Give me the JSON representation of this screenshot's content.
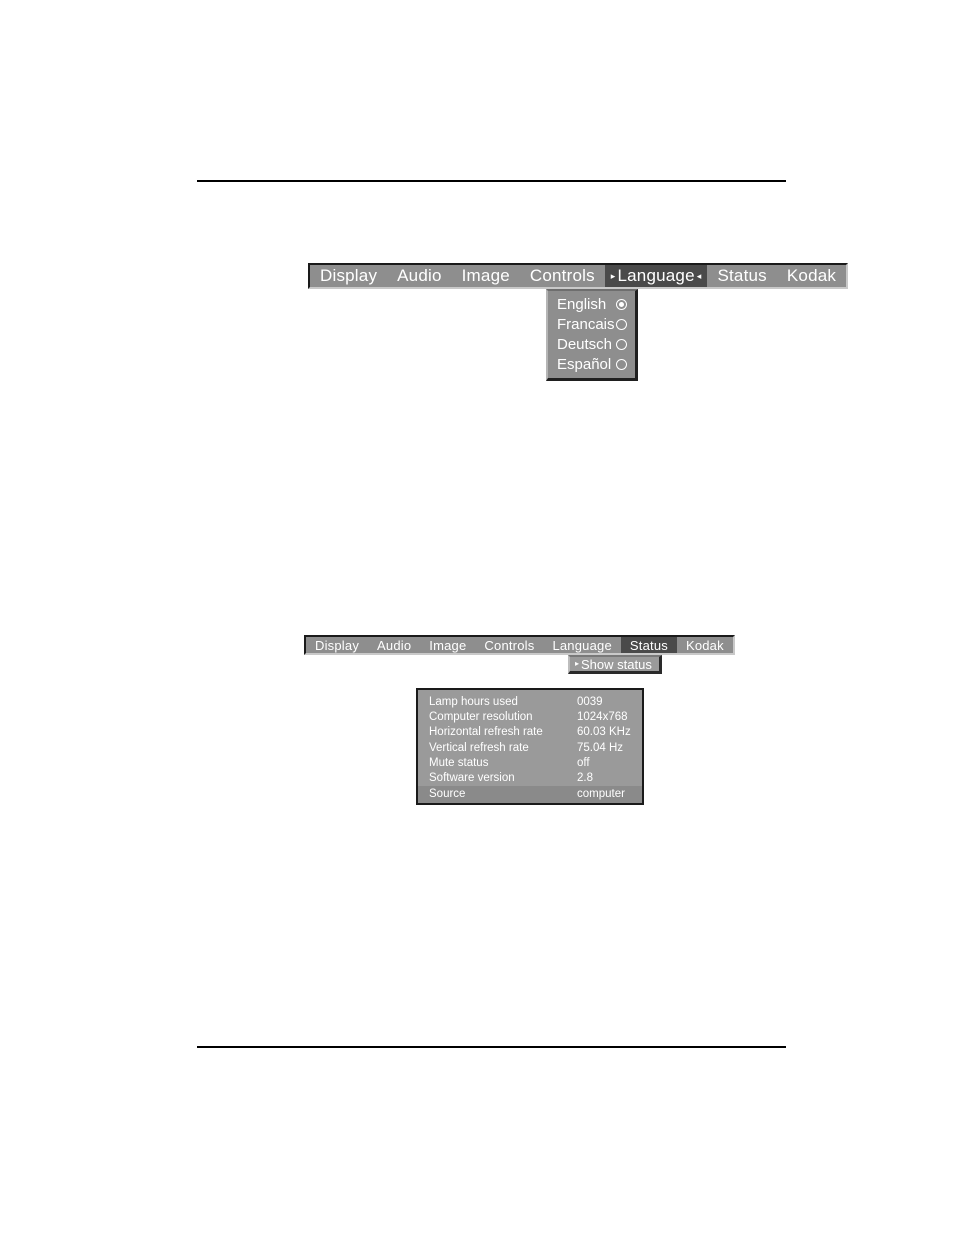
{
  "page": {
    "background_color": "#ffffff",
    "rule_color": "#000000"
  },
  "osd_language_screen": {
    "menubar": {
      "items": [
        {
          "label": "Display",
          "selected": false
        },
        {
          "label": "Audio",
          "selected": false
        },
        {
          "label": "Image",
          "selected": false
        },
        {
          "label": "Controls",
          "selected": false
        },
        {
          "label": "Language",
          "selected": true,
          "arrow_left": "▸",
          "arrow_right": "◂"
        },
        {
          "label": "Status",
          "selected": false
        },
        {
          "label": "Kodak",
          "selected": false
        }
      ],
      "bar_color": "#8e8e8e",
      "selected_color": "#4a4a4a",
      "text_color": "#ffffff"
    },
    "dropdown": {
      "options": [
        {
          "label": "English",
          "checked": true
        },
        {
          "label": "Francais",
          "checked": false
        },
        {
          "label": "Deutsch",
          "checked": false
        },
        {
          "label": "Español",
          "checked": false
        }
      ],
      "panel_color": "#8e8e8e"
    }
  },
  "osd_status_screen": {
    "menubar": {
      "items": [
        {
          "label": "Display",
          "selected": false
        },
        {
          "label": "Audio",
          "selected": false
        },
        {
          "label": "Image",
          "selected": false
        },
        {
          "label": "Controls",
          "selected": false
        },
        {
          "label": "Language",
          "selected": false
        },
        {
          "label": "Status",
          "selected": true
        },
        {
          "label": "Kodak",
          "selected": false
        }
      ],
      "bar_color": "#8e8e8e",
      "selected_color": "#4a4a4a",
      "text_color": "#ffffff"
    },
    "submenu": {
      "arrow": "▸",
      "label": "Show status"
    },
    "status_panel": {
      "rows": [
        {
          "label": "Lamp hours used",
          "value": "0039",
          "highlight": false
        },
        {
          "label": "Computer resolution",
          "value": "1024x768",
          "highlight": false
        },
        {
          "label": "Horizontal refresh rate",
          "value": "60.03 KHz",
          "highlight": false
        },
        {
          "label": "Vertical refresh rate",
          "value": "75.04 Hz",
          "highlight": false
        },
        {
          "label": "Mute status",
          "value": "off",
          "highlight": false
        },
        {
          "label": "Software version",
          "value": "2.8",
          "highlight": false
        },
        {
          "label": "Source",
          "value": "computer",
          "highlight": true
        }
      ],
      "panel_color": "#9a9a9a",
      "text_color": "#ffffff"
    }
  }
}
